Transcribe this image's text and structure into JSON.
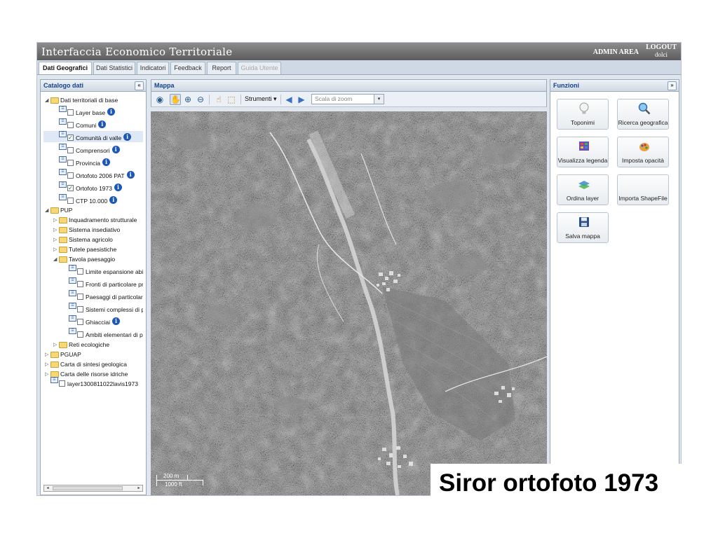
{
  "header": {
    "title": "Interfaccia Economico Territoriale",
    "admin_area": "ADMIN AREA",
    "logout": "LOGOUT",
    "user": "dolci"
  },
  "tabs": [
    {
      "label": "Dati Geografici",
      "state": "active"
    },
    {
      "label": "Dati Statistici",
      "state": "normal"
    },
    {
      "label": "Indicatori",
      "state": "normal"
    },
    {
      "label": "Feedback",
      "state": "normal"
    },
    {
      "label": "Report",
      "state": "normal"
    },
    {
      "label": "Guida Utente",
      "state": "disabled"
    }
  ],
  "catalog": {
    "title": "Catalogo dati",
    "collapse_glyph": "«",
    "tree": {
      "dati_territoriali": "Dati territoriali di base",
      "layers_base": [
        {
          "label": "Layer base",
          "checked": false,
          "info": true
        },
        {
          "label": "Comuni",
          "checked": false,
          "info": true
        },
        {
          "label": "Comunità di valle",
          "checked": true,
          "info": true,
          "selected": true
        },
        {
          "label": "Comprensori",
          "checked": false,
          "info": true
        },
        {
          "label": "Provincia",
          "checked": false,
          "info": true
        },
        {
          "label": "Ortofoto 2006 PAT",
          "checked": false,
          "info": true
        },
        {
          "label": "Ortofoto 1973",
          "checked": true,
          "info": true
        },
        {
          "label": "CTP 10.000",
          "checked": false,
          "info": true
        }
      ],
      "pup": "PUP",
      "pup_folders": [
        "Inquadramento strutturale",
        "Sistema insediativo",
        "Sistema agricolo",
        "Tutele paesistiche"
      ],
      "tavola": "Tavola paesaggio",
      "tavola_layers": [
        {
          "label": "Limite espansione abit",
          "checked": false,
          "info": false
        },
        {
          "label": "Fronti di particolare pre",
          "checked": false,
          "info": false
        },
        {
          "label": "Paesaggi di particolare",
          "checked": false,
          "info": false
        },
        {
          "label": "Sistemi complessi di pa",
          "checked": false,
          "info": false
        },
        {
          "label": "Ghiacciai",
          "checked": false,
          "info": true
        },
        {
          "label": "Ambiti elementari di pa",
          "checked": false,
          "info": false
        }
      ],
      "reti": "Reti ecologiche",
      "pguap": "PGUAP",
      "carta_geo": "Carta di sintesi geologica",
      "carta_idriche": "Carta delle risorse idriche",
      "extra_layer": "layer1300811022lavis1973"
    }
  },
  "map": {
    "title": "Mappa",
    "strumenti": "Strumenti ▾",
    "zoom_placeholder": "Scala di zoom",
    "scale_top": "200 m",
    "scale_bottom": "1000 ft"
  },
  "functions": {
    "title": "Funzioni",
    "collapse_glyph": "»",
    "buttons": [
      {
        "label": "Toponimi",
        "icon": "lightbulb-icon"
      },
      {
        "label": "Ricerca geografica",
        "icon": "magnifier-icon"
      },
      {
        "label": "Visualizza legenda",
        "icon": "legend-icon"
      },
      {
        "label": "Imposta opacità",
        "icon": "palette-icon"
      },
      {
        "label": "Ordina layer",
        "icon": "layers-icon"
      },
      {
        "label": "Importa ShapeFile",
        "icon": ""
      },
      {
        "label": "Salva mappa",
        "icon": "floppy-icon"
      }
    ]
  },
  "caption": "Siror ortofoto 1973"
}
